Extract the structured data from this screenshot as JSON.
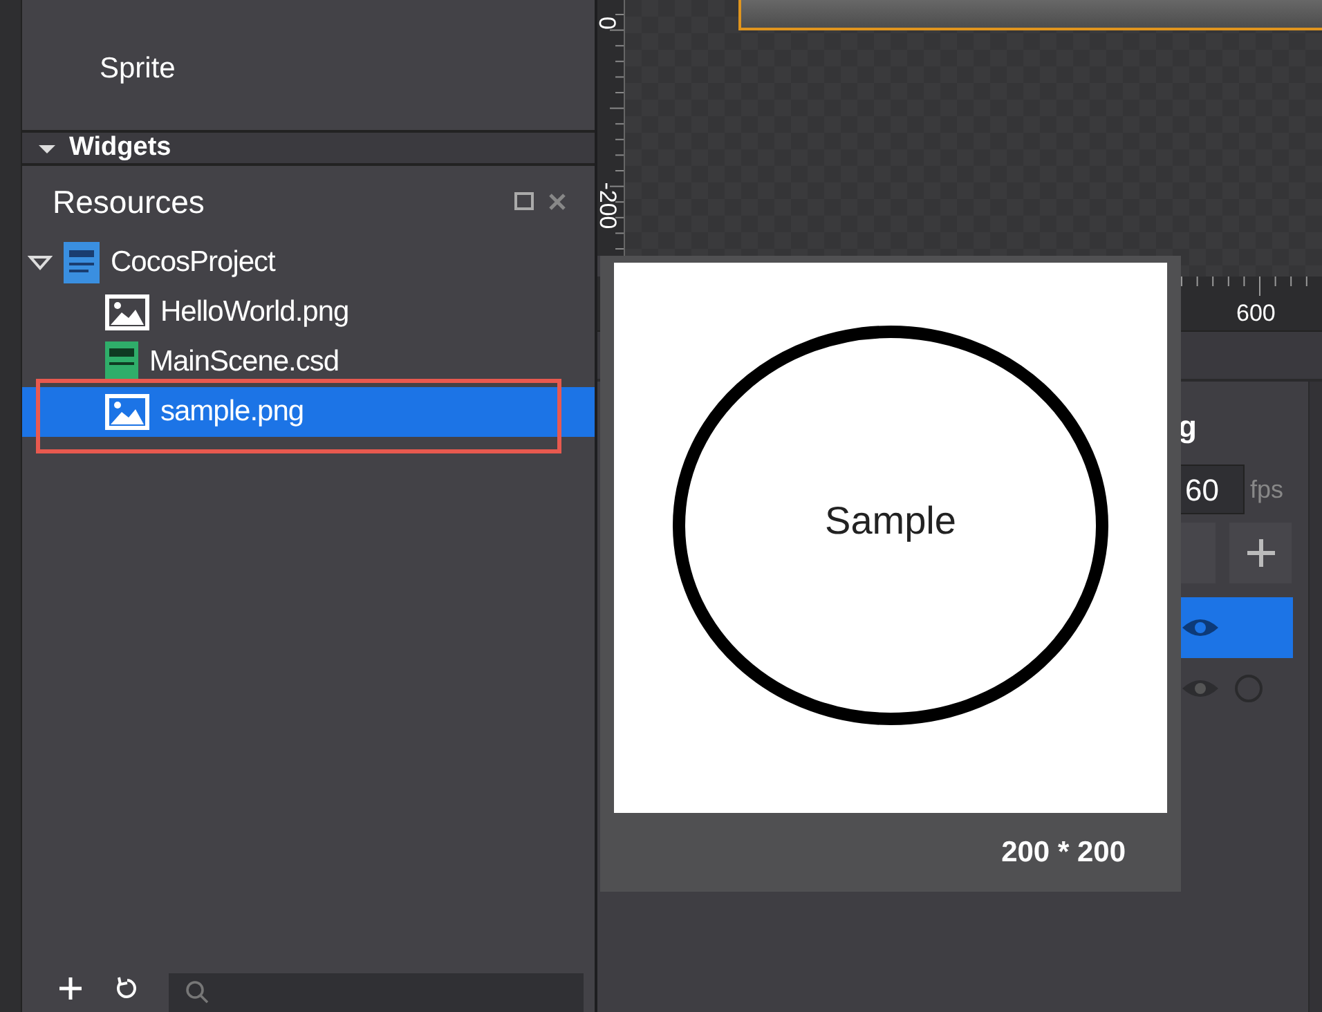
{
  "object_panel": {
    "items": [
      {
        "label": "Sprite"
      }
    ],
    "section": {
      "label": "Widgets",
      "expanded": true
    }
  },
  "resources": {
    "title": "Resources",
    "tree": [
      {
        "label": "CocosProject",
        "kind": "project",
        "expanded": true,
        "selected": false,
        "highlighted": false,
        "children": [
          {
            "label": "HelloWorld.png",
            "kind": "image",
            "selected": false,
            "highlighted": false
          },
          {
            "label": "MainScene.csd",
            "kind": "scene",
            "selected": false,
            "highlighted": false
          },
          {
            "label": "sample.png",
            "kind": "image",
            "selected": true,
            "highlighted": true
          }
        ]
      }
    ]
  },
  "rulers": {
    "vertical": [
      "0",
      "-200"
    ],
    "horizontal": [
      "600"
    ]
  },
  "preview": {
    "image_text": "Sample",
    "size": "200 * 200"
  },
  "timeline": {
    "title": "g",
    "fps": "60",
    "fps_unit": "fps",
    "layers": [
      {
        "selected": true
      },
      {
        "selected": false
      }
    ]
  }
}
